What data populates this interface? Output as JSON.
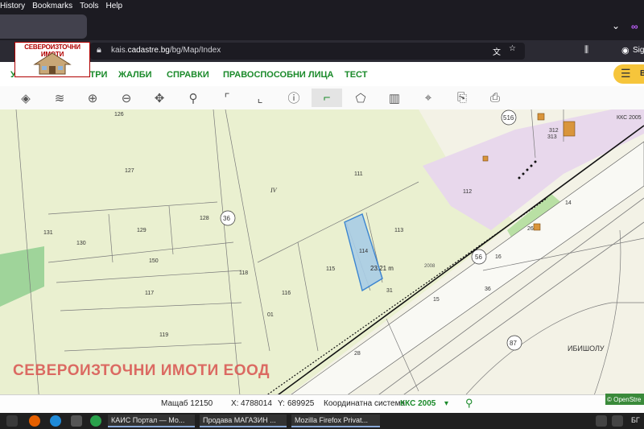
{
  "menubar": {
    "items": [
      "History",
      "Bookmarks",
      "Tools",
      "Help"
    ]
  },
  "browser": {
    "url_prefix": "kais.",
    "url_host": "cadastre.bg",
    "url_path": "/bg/Map/Index",
    "right_label": "Sig"
  },
  "logo": {
    "title": "СЕВЕРОИЗТОЧНИ ИМОТИ"
  },
  "nav": {
    "items": [
      "УСЛУГИ",
      "РЕГИСТРИ",
      "ЖАЛБИ",
      "СПРАВКИ",
      "ПРАВОСПОСОБНИ ЛИЦА",
      "ТЕСТ"
    ]
  },
  "toolbar": {
    "tools": [
      "layers-icon",
      "stack-icon",
      "zoom-in-icon",
      "zoom-out-icon",
      "pan-icon",
      "marker-icon",
      "select-rect-icon",
      "deselect-icon",
      "info-icon",
      "measure-distance-icon",
      "measure-area-icon",
      "map-icon",
      "coordinates-icon",
      "export-icon",
      "print-icon"
    ],
    "active_index": 9
  },
  "map": {
    "kks_label": "ККС 2005",
    "measurement": "23.21 m",
    "road_label": "2008",
    "street_label": "ИБИШОЛУ",
    "block_label": "IV",
    "parcels": [
      "126",
      "127",
      "128",
      "129",
      "130",
      "131",
      "150",
      "117",
      "118",
      "119",
      "116",
      "115",
      "114",
      "113",
      "111",
      "112",
      "516",
      "312",
      "313",
      "14",
      "26",
      "16",
      "15",
      "31",
      "28",
      "56",
      "36",
      "87",
      "01"
    ]
  },
  "watermark": "СЕВЕРОИЗТОЧНИ ИМОТИ ЕООД",
  "status": {
    "scale_label": "Мащаб 1:",
    "scale_value": "2150",
    "x_label": "X:",
    "x_value": "4788014",
    "y_label": "Y:",
    "y_value": "689925",
    "coord_label": "Координатна система:",
    "coord_value": "ККС 2005"
  },
  "attribution": "© OpenStre",
  "taskbar": {
    "tasks": [
      "КАИС Портал — Мо...",
      "Продава МАГАЗИН ...",
      "Mozilla Firefox Privat..."
    ],
    "tray": "БГ"
  }
}
